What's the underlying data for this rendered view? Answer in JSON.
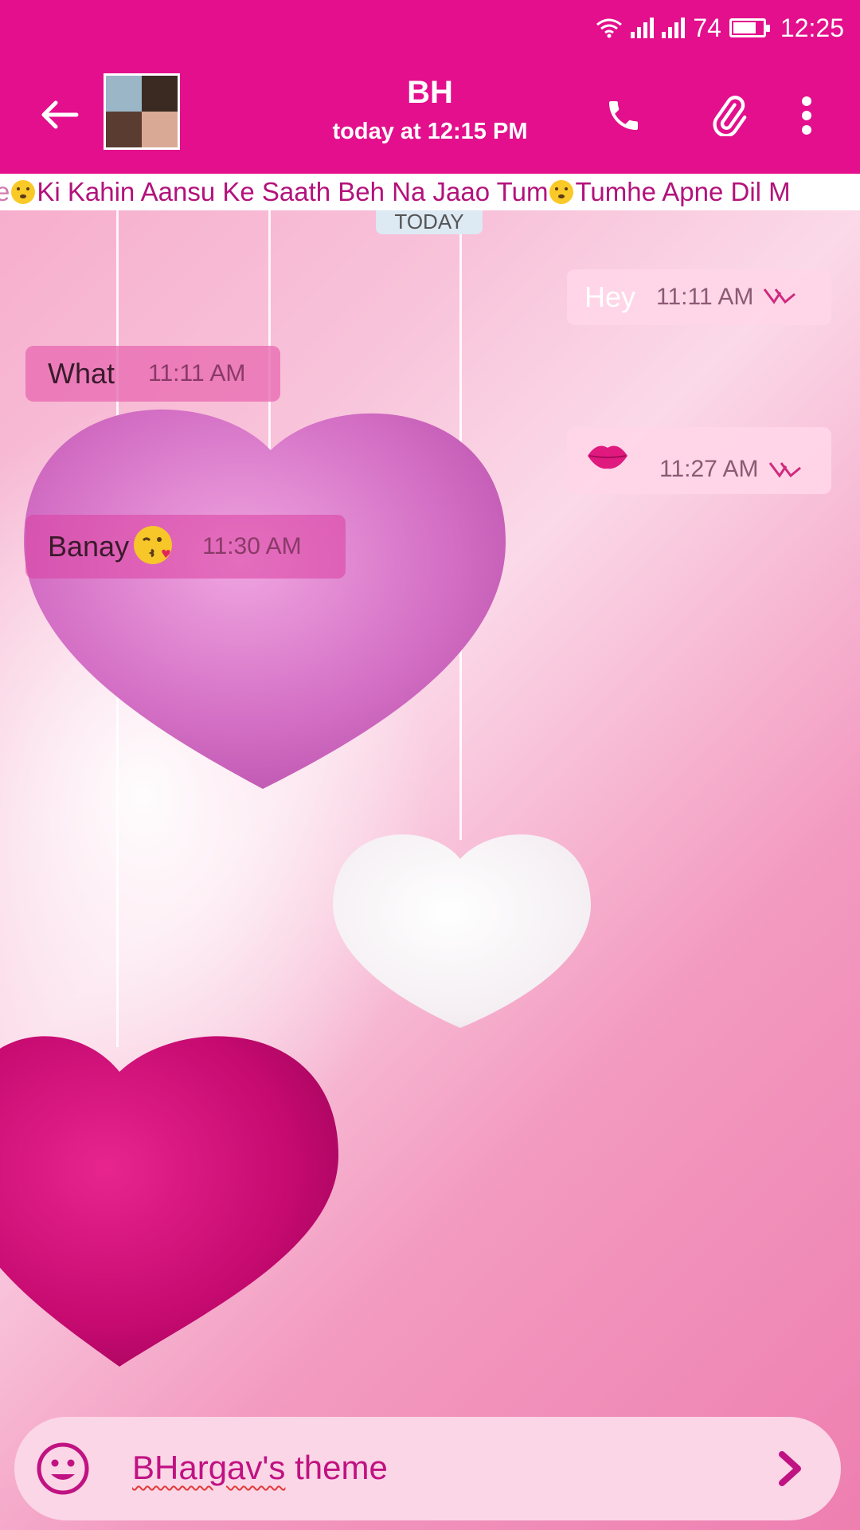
{
  "status_bar": {
    "battery": "74",
    "time": "12:25"
  },
  "app_bar": {
    "contact_name": "BH",
    "last_seen": "today at 12:15 PM",
    "icons": [
      "back-arrow-icon",
      "phone-icon",
      "paperclip-icon",
      "more-vert-icon"
    ]
  },
  "ticker": {
    "lead_fragment": "e",
    "part1": "Ki Kahin Aansu Ke Saath Beh Na Jaao Tum",
    "part2": "Tumhe Apne Dil M"
  },
  "date_separator": "TODAY",
  "messages": [
    {
      "direction": "outgoing",
      "text": "Hey",
      "time": "11:11 AM",
      "status_icon": "double-tick-icon"
    },
    {
      "direction": "incoming",
      "text": "What",
      "time": "11:11 AM"
    },
    {
      "direction": "outgoing",
      "text": "",
      "sticker": "kiss-lips-icon",
      "time": "11:27 AM",
      "status_icon": "double-tick-icon"
    },
    {
      "direction": "incoming",
      "text": "Banay",
      "emoji": "kissing-face-icon",
      "time": "11:30 AM"
    }
  ],
  "composer": {
    "value": "BHargav's theme",
    "value_parts": [
      "BHargav's",
      " theme"
    ],
    "emoji_button_icon": "smiley-icon",
    "send_icon": "chevron-right-icon"
  },
  "colors": {
    "primary": "#e30f8c",
    "accent_text": "#c01282",
    "ticker_text": "#b3127b"
  }
}
